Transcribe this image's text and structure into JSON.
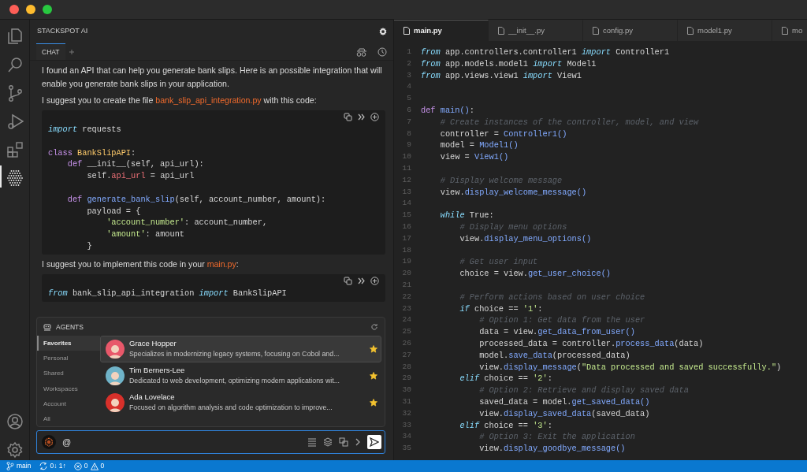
{
  "activity_bar": {
    "items": [
      {
        "kind": "files",
        "selected": false
      },
      {
        "kind": "search",
        "selected": false
      },
      {
        "kind": "scm",
        "selected": false
      },
      {
        "kind": "run",
        "selected": false
      },
      {
        "kind": "extensions",
        "selected": false
      },
      {
        "kind": "hexagon",
        "selected": true
      }
    ]
  },
  "chat": {
    "title": "STACKSPOT AI",
    "tabs": [
      {
        "label": "CHAT",
        "selected": true
      }
    ],
    "messages": [
      {
        "kind": "paragraph",
        "parts": [
          {
            "kind": "text",
            "text": "I found an API that can help you generate bank slips. Here is an possible integration that will enable you generate bank slips in your application."
          }
        ]
      },
      {
        "kind": "paragraph",
        "parts": [
          {
            "kind": "text",
            "text": "I suggest you to create the file "
          },
          {
            "kind": "file",
            "text": "bank_slip_api_integration.py"
          },
          {
            "kind": "text",
            "text": " with this code:"
          }
        ]
      },
      {
        "kind": "code",
        "lines": [
          {
            "kind": "code",
            "tokens": [
              {
                "kind": "keyword",
                "text": "import"
              },
              {
                "kind": "plain",
                "text": " requests"
              }
            ]
          },
          {
            "kind": "blank"
          },
          {
            "kind": "code",
            "tokens": [
              {
                "kind": "def",
                "text": "class "
              },
              {
                "kind": "class",
                "text": "BankSlipAPI"
              },
              {
                "kind": "plain",
                "text": ":"
              }
            ]
          },
          {
            "kind": "code",
            "tokens": [
              {
                "kind": "def",
                "text": "    def "
              },
              {
                "kind": "plain",
                "text": "__init__(self, api_url):"
              }
            ]
          },
          {
            "kind": "code",
            "tokens": [
              {
                "kind": "plain",
                "text": "        self."
              },
              {
                "kind": "attr",
                "text": "api_url"
              },
              {
                "kind": "plain",
                "text": " = api_url"
              }
            ]
          },
          {
            "kind": "blank"
          },
          {
            "kind": "code",
            "tokens": [
              {
                "kind": "def",
                "text": "    def "
              },
              {
                "kind": "function",
                "text": "generate_bank_slip"
              },
              {
                "kind": "plain",
                "text": "(self, account_number, amount):"
              }
            ]
          },
          {
            "kind": "code",
            "tokens": [
              {
                "kind": "plain",
                "text": "        payload = {"
              }
            ]
          },
          {
            "kind": "code",
            "tokens": [
              {
                "kind": "string",
                "text": "            'account_number'"
              },
              {
                "kind": "plain",
                "text": ": account_number,"
              }
            ]
          },
          {
            "kind": "code",
            "tokens": [
              {
                "kind": "string",
                "text": "            'amount'"
              },
              {
                "kind": "plain",
                "text": ": amount"
              }
            ]
          },
          {
            "kind": "code",
            "tokens": [
              {
                "kind": "plain",
                "text": "        }"
              }
            ]
          }
        ]
      },
      {
        "kind": "paragraph",
        "parts": [
          {
            "kind": "text",
            "text": "I suggest you to implement this code in your "
          },
          {
            "kind": "file",
            "text": "main.py"
          },
          {
            "kind": "text",
            "text": ":"
          }
        ]
      },
      {
        "kind": "code",
        "lines": [
          {
            "kind": "code",
            "tokens": [
              {
                "kind": "keyword",
                "text": "from"
              },
              {
                "kind": "plain",
                "text": " bank_slip_api_integration "
              },
              {
                "kind": "keyword",
                "text": "import"
              },
              {
                "kind": "plain",
                "text": " BankSlipAPI"
              }
            ]
          }
        ]
      }
    ],
    "agents": {
      "title": "AGENTS",
      "categories": [
        {
          "label": "Favorites",
          "selected": true
        },
        {
          "label": "Personal",
          "selected": false
        },
        {
          "label": "Shared",
          "selected": false
        },
        {
          "label": "Workspaces",
          "selected": false
        },
        {
          "label": "Account",
          "selected": false
        },
        {
          "label": "All",
          "selected": false
        }
      ],
      "items": [
        {
          "name": "Grace Hopper",
          "description": "Specializes in modernizing legacy systems, focusing on Cobol and...",
          "color": "#e8586a",
          "favorite": true,
          "selected": true
        },
        {
          "name": "Tim Berners-Lee",
          "description": "Dedicated to web development, optimizing modern applications wit...",
          "color": "#6fb3c8",
          "favorite": true,
          "selected": false
        },
        {
          "name": "Ada Lovelace",
          "description": "Focused on algorithm analysis and code optimization to improve...",
          "color": "#d8302a",
          "favorite": true,
          "selected": false
        }
      ]
    },
    "input": {
      "value": "@"
    }
  },
  "editor": {
    "tabs": [
      {
        "label": "main.py",
        "selected": true
      },
      {
        "label": "__init__.py",
        "selected": false
      },
      {
        "label": "config.py",
        "selected": false
      },
      {
        "label": "model1.py",
        "selected": false
      },
      {
        "label": "mo",
        "selected": false
      }
    ],
    "lines": [
      {
        "number": "1",
        "kind": "code",
        "tokens": [
          {
            "kind": "keyword",
            "text": "from"
          },
          {
            "kind": "plain",
            "text": " app.controllers.controller1 "
          },
          {
            "kind": "keyword",
            "text": "import"
          },
          {
            "kind": "plain",
            "text": " Controller1"
          }
        ]
      },
      {
        "number": "2",
        "kind": "code",
        "tokens": [
          {
            "kind": "keyword",
            "text": "from"
          },
          {
            "kind": "plain",
            "text": " app.models.model1 "
          },
          {
            "kind": "keyword",
            "text": "import"
          },
          {
            "kind": "plain",
            "text": " Model1"
          }
        ]
      },
      {
        "number": "3",
        "kind": "code",
        "tokens": [
          {
            "kind": "keyword",
            "text": "from"
          },
          {
            "kind": "plain",
            "text": " app.views.view1 "
          },
          {
            "kind": "keyword",
            "text": "import"
          },
          {
            "kind": "plain",
            "text": " View1"
          }
        ]
      },
      {
        "number": "4",
        "kind": "blank"
      },
      {
        "number": "5",
        "kind": "blank"
      },
      {
        "number": "6",
        "kind": "code",
        "tokens": [
          {
            "kind": "def",
            "text": "def "
          },
          {
            "kind": "function",
            "text": "main()"
          },
          {
            "kind": "plain",
            "text": ":"
          }
        ]
      },
      {
        "number": "7",
        "kind": "code",
        "tokens": [
          {
            "kind": "comment",
            "text": "    # Create instances of the controller, model, and view"
          }
        ]
      },
      {
        "number": "8",
        "kind": "code",
        "tokens": [
          {
            "kind": "plain",
            "text": "    controller = "
          },
          {
            "kind": "function",
            "text": "Controller1()"
          }
        ]
      },
      {
        "number": "9",
        "kind": "code",
        "tokens": [
          {
            "kind": "plain",
            "text": "    model = "
          },
          {
            "kind": "function",
            "text": "Model1()"
          }
        ]
      },
      {
        "number": "10",
        "kind": "code",
        "tokens": [
          {
            "kind": "plain",
            "text": "    view = "
          },
          {
            "kind": "function",
            "text": "View1()"
          }
        ]
      },
      {
        "number": "11",
        "kind": "blank"
      },
      {
        "number": "12",
        "kind": "code",
        "tokens": [
          {
            "kind": "comment",
            "text": "    # Display welcome message"
          }
        ]
      },
      {
        "number": "13",
        "kind": "code",
        "tokens": [
          {
            "kind": "plain",
            "text": "    view."
          },
          {
            "kind": "function",
            "text": "display_welcome_message()"
          }
        ]
      },
      {
        "number": "14",
        "kind": "blank"
      },
      {
        "number": "15",
        "kind": "code",
        "tokens": [
          {
            "kind": "keyword",
            "text": "    while"
          },
          {
            "kind": "plain",
            "text": " True:"
          }
        ]
      },
      {
        "number": "16",
        "kind": "code",
        "tokens": [
          {
            "kind": "comment",
            "text": "        # Display menu options"
          }
        ]
      },
      {
        "number": "17",
        "kind": "code",
        "tokens": [
          {
            "kind": "plain",
            "text": "        view."
          },
          {
            "kind": "function",
            "text": "display_menu_options()"
          }
        ]
      },
      {
        "number": "18",
        "kind": "blank"
      },
      {
        "number": "19",
        "kind": "code",
        "tokens": [
          {
            "kind": "comment",
            "text": "        # Get user input"
          }
        ]
      },
      {
        "number": "20",
        "kind": "code",
        "tokens": [
          {
            "kind": "plain",
            "text": "        choice = view."
          },
          {
            "kind": "function",
            "text": "get_user_choice()"
          }
        ]
      },
      {
        "number": "21",
        "kind": "blank"
      },
      {
        "number": "22",
        "kind": "code",
        "tokens": [
          {
            "kind": "comment",
            "text": "        # Perform actions based on user choice"
          }
        ]
      },
      {
        "number": "23",
        "kind": "code",
        "tokens": [
          {
            "kind": "keyword",
            "text": "        if"
          },
          {
            "kind": "plain",
            "text": " choice == "
          },
          {
            "kind": "string",
            "text": "'1'"
          },
          {
            "kind": "plain",
            "text": ":"
          }
        ]
      },
      {
        "number": "24",
        "kind": "code",
        "tokens": [
          {
            "kind": "comment",
            "text": "            # Option 1: Get data from the user"
          }
        ]
      },
      {
        "number": "25",
        "kind": "code",
        "tokens": [
          {
            "kind": "plain",
            "text": "            data = view."
          },
          {
            "kind": "function",
            "text": "get_data_from_user()"
          }
        ]
      },
      {
        "number": "26",
        "kind": "code",
        "tokens": [
          {
            "kind": "plain",
            "text": "            processed_data = controller."
          },
          {
            "kind": "function",
            "text": "process_data"
          },
          {
            "kind": "plain",
            "text": "(data)"
          }
        ]
      },
      {
        "number": "27",
        "kind": "code",
        "tokens": [
          {
            "kind": "plain",
            "text": "            model."
          },
          {
            "kind": "function",
            "text": "save_data"
          },
          {
            "kind": "plain",
            "text": "(processed_data)"
          }
        ]
      },
      {
        "number": "28",
        "kind": "code",
        "tokens": [
          {
            "kind": "plain",
            "text": "            view."
          },
          {
            "kind": "function",
            "text": "display_message"
          },
          {
            "kind": "plain",
            "text": "("
          },
          {
            "kind": "string",
            "text": "\"Data processed and saved successfully.\""
          },
          {
            "kind": "plain",
            "text": ")"
          }
        ]
      },
      {
        "number": "29",
        "kind": "code",
        "tokens": [
          {
            "kind": "keyword",
            "text": "        elif"
          },
          {
            "kind": "plain",
            "text": " choice == "
          },
          {
            "kind": "string",
            "text": "'2'"
          },
          {
            "kind": "plain",
            "text": ":"
          }
        ]
      },
      {
        "number": "30",
        "kind": "code",
        "tokens": [
          {
            "kind": "comment",
            "text": "            # Option 2: Retrieve and display saved data"
          }
        ]
      },
      {
        "number": "31",
        "kind": "code",
        "tokens": [
          {
            "kind": "plain",
            "text": "            saved_data = model."
          },
          {
            "kind": "function",
            "text": "get_saved_data()"
          }
        ]
      },
      {
        "number": "32",
        "kind": "code",
        "tokens": [
          {
            "kind": "plain",
            "text": "            view."
          },
          {
            "kind": "function",
            "text": "display_saved_data"
          },
          {
            "kind": "plain",
            "text": "(saved_data)"
          }
        ]
      },
      {
        "number": "33",
        "kind": "code",
        "tokens": [
          {
            "kind": "keyword",
            "text": "        elif"
          },
          {
            "kind": "plain",
            "text": " choice == "
          },
          {
            "kind": "string",
            "text": "'3'"
          },
          {
            "kind": "plain",
            "text": ":"
          }
        ]
      },
      {
        "number": "34",
        "kind": "code",
        "tokens": [
          {
            "kind": "comment",
            "text": "            # Option 3: Exit the application"
          }
        ]
      },
      {
        "number": "35",
        "kind": "code",
        "tokens": [
          {
            "kind": "plain",
            "text": "            view."
          },
          {
            "kind": "function",
            "text": "display_goodbye_message()"
          }
        ]
      }
    ]
  },
  "status_bar": {
    "branch": "main",
    "sync": "0↓ 1↑",
    "errors": "0",
    "warnings": "0"
  }
}
